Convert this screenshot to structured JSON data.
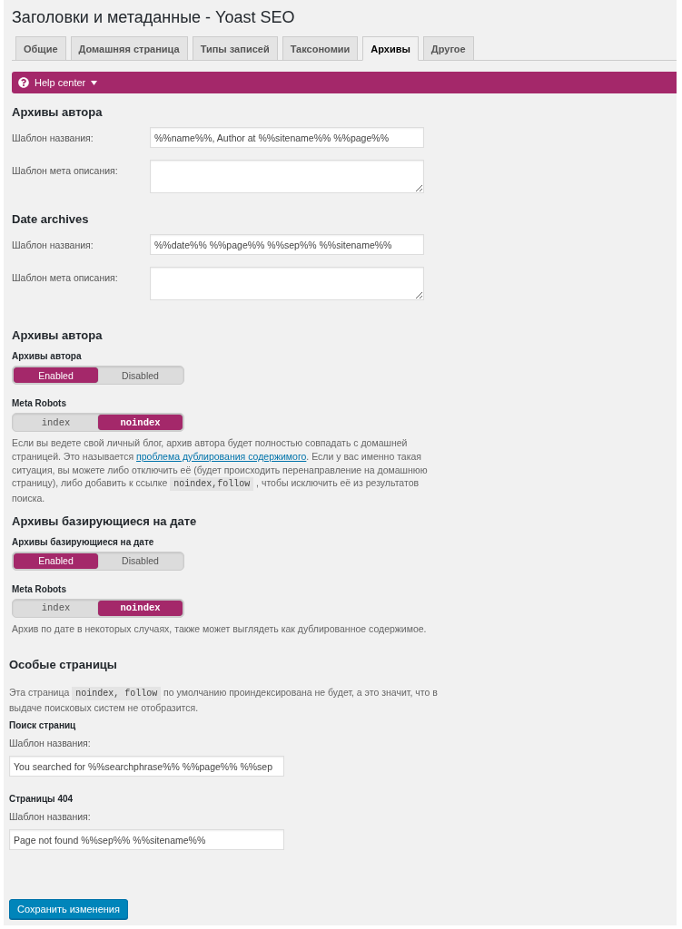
{
  "page_title": "Заголовки и метаданные - Yoast SEO",
  "tabs": [
    {
      "label": "Общие",
      "selected": false
    },
    {
      "label": "Домашняя страница",
      "selected": false
    },
    {
      "label": "Типы записей",
      "selected": false
    },
    {
      "label": "Таксономии",
      "selected": false
    },
    {
      "label": "Архивы",
      "selected": true
    },
    {
      "label": "Другое",
      "selected": false
    }
  ],
  "help_center": {
    "label": "Help center"
  },
  "template_sections": [
    {
      "title": "Архивы автора",
      "fields": [
        {
          "kind": "input",
          "label": "Шаблон названия:",
          "value": "%%name%%, Author at %%sitename%% %%page%%"
        },
        {
          "kind": "textarea",
          "label": "Шаблон мета описания:"
        }
      ]
    },
    {
      "title": "Date archives",
      "fields": [
        {
          "kind": "input",
          "label": "Шаблон названия:",
          "value": "%%date%% %%page%% %%sep%% %%sitename%%"
        },
        {
          "kind": "textarea",
          "label": "Шаблон мета описания:"
        }
      ]
    }
  ],
  "archive_sections": [
    {
      "title": "Архивы автора",
      "switches": [
        {
          "label": "Архивы автора",
          "kind": "text",
          "options": [
            {
              "label": "Enabled",
              "selected": true
            },
            {
              "label": "Disabled",
              "selected": false
            }
          ]
        },
        {
          "label": "Meta Robots",
          "kind": "code",
          "options": [
            {
              "label": "index",
              "selected": false
            },
            {
              "label": "noindex",
              "selected": true
            }
          ]
        }
      ],
      "note": [
        {
          "kind": "text",
          "text": "Если вы ведете свой личный блог, архив автора будет полностью совпадать с домашней страницей. Это называется "
        },
        {
          "kind": "link",
          "text": "проблема дублирования содержимого"
        },
        {
          "kind": "text",
          "text": ". Если у вас именно такая ситуация, вы можете либо отключить её (будет происходить перенаправление на домашнюю страницу), либо добавить к ссылке "
        },
        {
          "kind": "code",
          "text": "noindex,follow"
        },
        {
          "kind": "text",
          "text": " , чтобы исключить её из результатов поиска."
        }
      ]
    },
    {
      "title": "Архивы базирующиеся на дате",
      "switches": [
        {
          "label": "Архивы базирующиеся на дате",
          "kind": "text",
          "options": [
            {
              "label": "Enabled",
              "selected": true
            },
            {
              "label": "Disabled",
              "selected": false
            }
          ]
        },
        {
          "label": "Meta Robots",
          "kind": "code",
          "options": [
            {
              "label": "index",
              "selected": false
            },
            {
              "label": "noindex",
              "selected": true
            }
          ]
        }
      ],
      "note": [
        {
          "kind": "text",
          "text": "Архив по дате в некоторых случаях, также может выглядеть как дублированное содержимое."
        }
      ]
    }
  ],
  "special_pages": {
    "title": "Особые страницы",
    "note": [
      {
        "kind": "text",
        "text": "Эта страница "
      },
      {
        "kind": "code",
        "text": "noindex, follow"
      },
      {
        "kind": "text",
        "text": " по умолчанию проиндексирована не будет, а это значит, что в выдаче поисковых систем не отобразится."
      }
    ],
    "groups": [
      {
        "title": "Поиск страниц",
        "label": "Шаблон названия:",
        "value": "You searched for %%searchphrase%% %%page%% %%sep"
      },
      {
        "title": "Страницы 404",
        "label": "Шаблон названия:",
        "value": "Page not found %%sep%% %%sitename%%"
      }
    ]
  },
  "save_button": {
    "label": "Сохранить изменения"
  }
}
